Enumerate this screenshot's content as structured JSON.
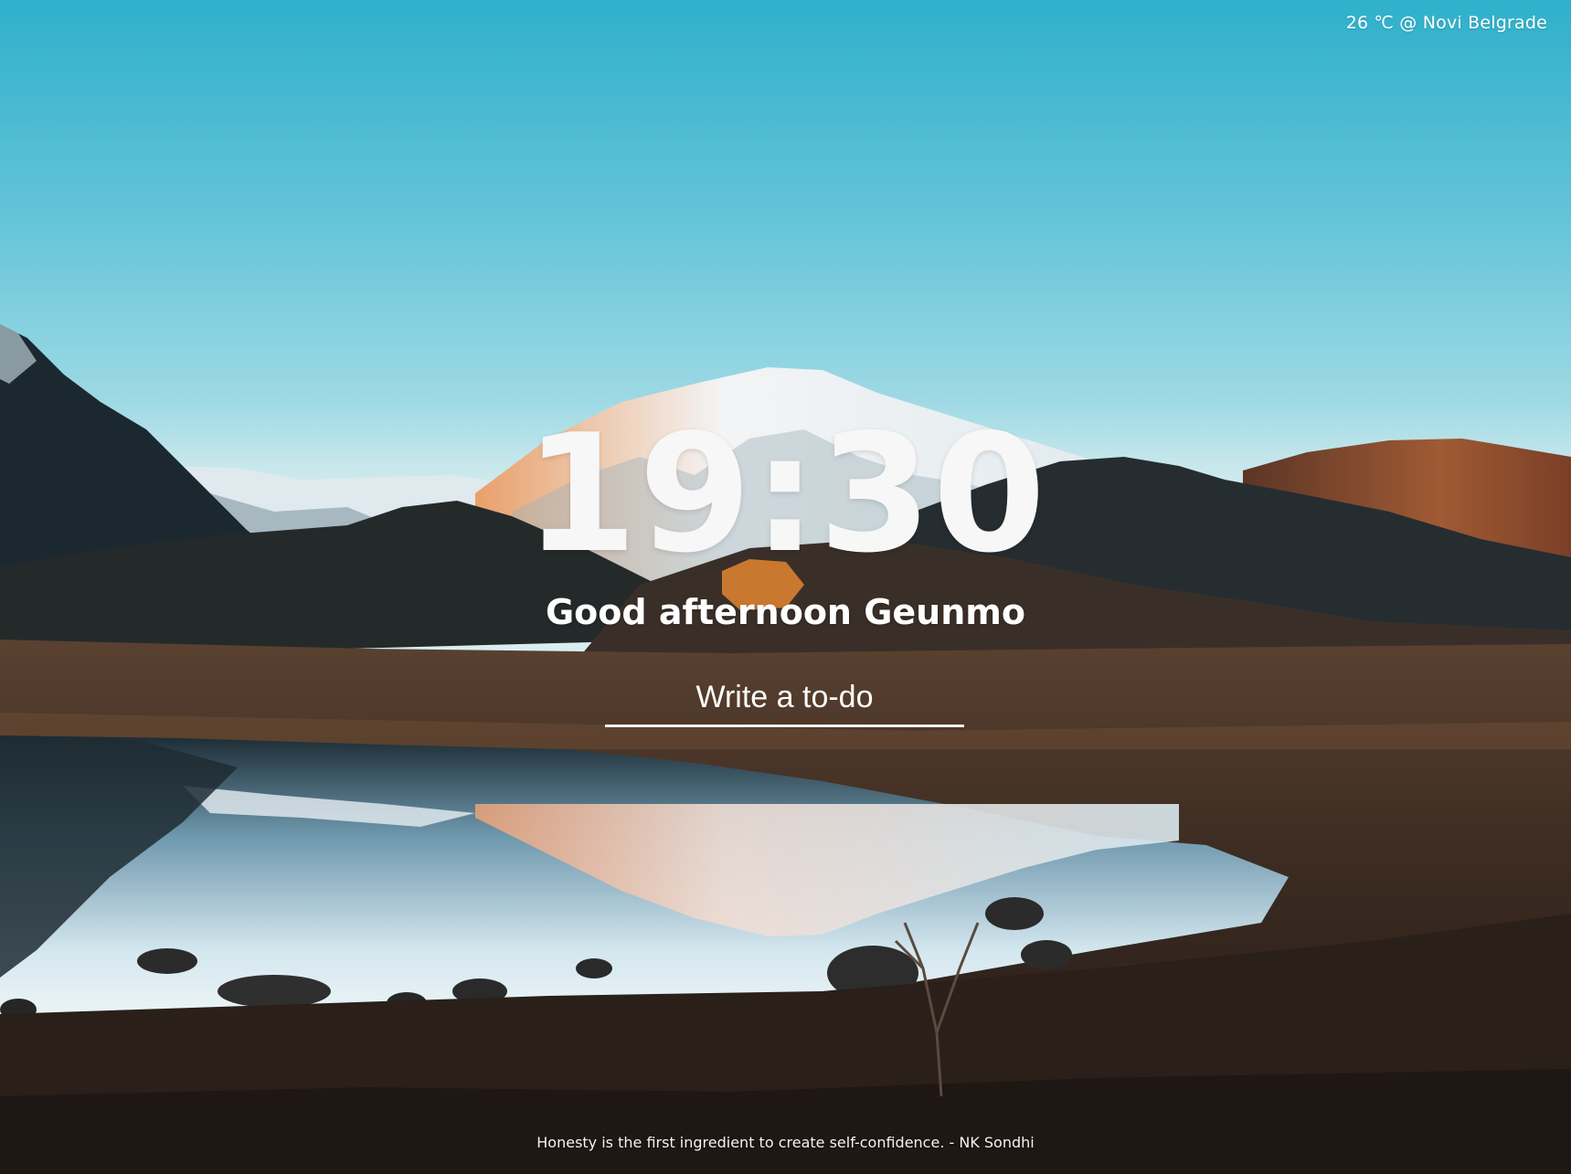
{
  "weather": {
    "text": "26 ℃ @ Novi Belgrade"
  },
  "clock": {
    "time": "19:30"
  },
  "greeting": {
    "text": "Good afternoon Geunmo"
  },
  "todo": {
    "placeholder": "Write a to-do",
    "value": ""
  },
  "quote": {
    "text": "Honesty is the first ingredient to create self-confidence. - NK Sondhi"
  },
  "background": {
    "description_icon": "mountain-lake-wallpaper",
    "colors": {
      "sky_top": "#2fb0cb",
      "sky_bottom": "#d9eef0",
      "snow": "#eef3f6",
      "rock": "#1f2a30",
      "ground": "#4a3526"
    }
  }
}
